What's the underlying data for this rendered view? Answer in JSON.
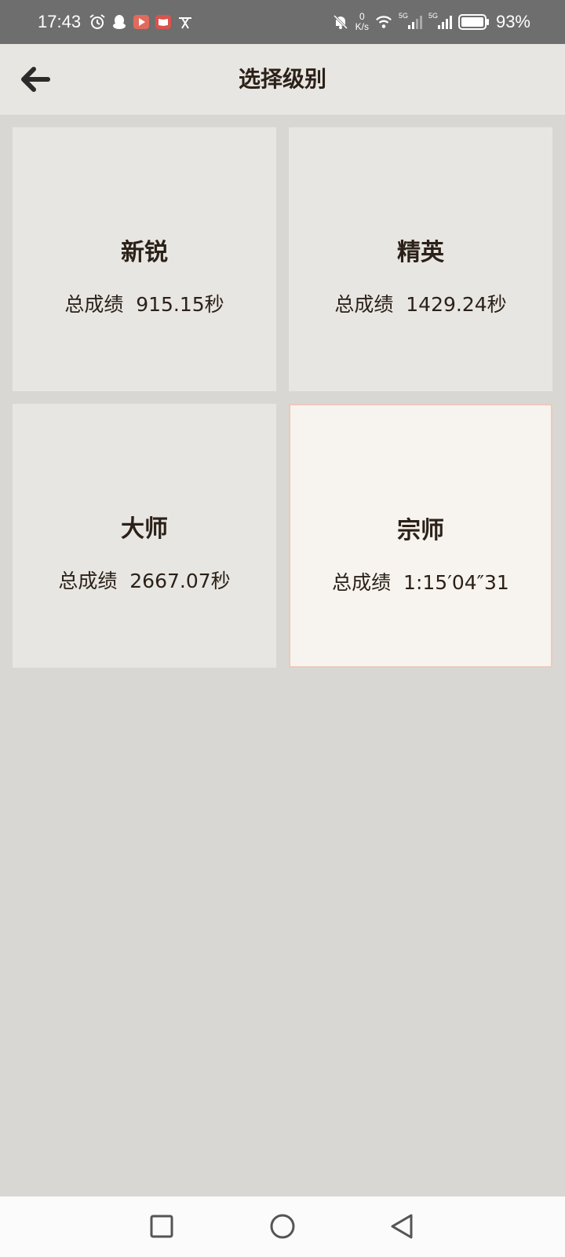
{
  "status_bar": {
    "time": "17:43",
    "net_speed_value": "0",
    "net_speed_unit": "K/s",
    "signal1_label": "5G",
    "signal2_label": "5G",
    "battery": "93%",
    "icons": [
      "alarm-icon",
      "qq-icon",
      "video-app-icon",
      "reader-app-icon",
      "translate-icon",
      "bell-off-icon",
      "wifi-icon",
      "signal-icon",
      "battery-icon"
    ]
  },
  "app_bar": {
    "title": "选择级别",
    "back_icon": "arrow-left-icon"
  },
  "levels": [
    {
      "name": "新锐",
      "score": "总成绩  915.15秒",
      "selected": false
    },
    {
      "name": "精英",
      "score": "总成绩  1429.24秒",
      "selected": false
    },
    {
      "name": "大师",
      "score": "总成绩  2667.07秒",
      "selected": false
    },
    {
      "name": "宗师",
      "score": "总成绩  1:15′04″31",
      "selected": true
    }
  ],
  "nav_bar": {
    "icons": [
      "recents-square-icon",
      "home-circle-icon",
      "back-triangle-icon"
    ]
  },
  "colors": {
    "status_bar_bg": "#6e6e6e",
    "app_bar_bg": "#e8e6e2",
    "page_bg": "#d9d7d3",
    "card_bg": "#e8e6e2",
    "selected_card_bg": "#f7f3ee",
    "selected_card_border": "#ecc9bd",
    "text": "#2b2118"
  }
}
